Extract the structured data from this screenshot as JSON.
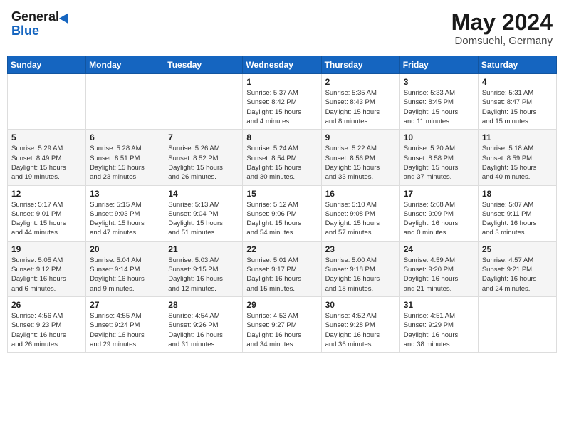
{
  "header": {
    "logo_general": "General",
    "logo_blue": "Blue",
    "title": "May 2024",
    "location": "Domsuehl, Germany"
  },
  "days_of_week": [
    "Sunday",
    "Monday",
    "Tuesday",
    "Wednesday",
    "Thursday",
    "Friday",
    "Saturday"
  ],
  "weeks": [
    [
      {
        "day": "",
        "info": ""
      },
      {
        "day": "",
        "info": ""
      },
      {
        "day": "",
        "info": ""
      },
      {
        "day": "1",
        "info": "Sunrise: 5:37 AM\nSunset: 8:42 PM\nDaylight: 15 hours\nand 4 minutes."
      },
      {
        "day": "2",
        "info": "Sunrise: 5:35 AM\nSunset: 8:43 PM\nDaylight: 15 hours\nand 8 minutes."
      },
      {
        "day": "3",
        "info": "Sunrise: 5:33 AM\nSunset: 8:45 PM\nDaylight: 15 hours\nand 11 minutes."
      },
      {
        "day": "4",
        "info": "Sunrise: 5:31 AM\nSunset: 8:47 PM\nDaylight: 15 hours\nand 15 minutes."
      }
    ],
    [
      {
        "day": "5",
        "info": "Sunrise: 5:29 AM\nSunset: 8:49 PM\nDaylight: 15 hours\nand 19 minutes."
      },
      {
        "day": "6",
        "info": "Sunrise: 5:28 AM\nSunset: 8:51 PM\nDaylight: 15 hours\nand 23 minutes."
      },
      {
        "day": "7",
        "info": "Sunrise: 5:26 AM\nSunset: 8:52 PM\nDaylight: 15 hours\nand 26 minutes."
      },
      {
        "day": "8",
        "info": "Sunrise: 5:24 AM\nSunset: 8:54 PM\nDaylight: 15 hours\nand 30 minutes."
      },
      {
        "day": "9",
        "info": "Sunrise: 5:22 AM\nSunset: 8:56 PM\nDaylight: 15 hours\nand 33 minutes."
      },
      {
        "day": "10",
        "info": "Sunrise: 5:20 AM\nSunset: 8:58 PM\nDaylight: 15 hours\nand 37 minutes."
      },
      {
        "day": "11",
        "info": "Sunrise: 5:18 AM\nSunset: 8:59 PM\nDaylight: 15 hours\nand 40 minutes."
      }
    ],
    [
      {
        "day": "12",
        "info": "Sunrise: 5:17 AM\nSunset: 9:01 PM\nDaylight: 15 hours\nand 44 minutes."
      },
      {
        "day": "13",
        "info": "Sunrise: 5:15 AM\nSunset: 9:03 PM\nDaylight: 15 hours\nand 47 minutes."
      },
      {
        "day": "14",
        "info": "Sunrise: 5:13 AM\nSunset: 9:04 PM\nDaylight: 15 hours\nand 51 minutes."
      },
      {
        "day": "15",
        "info": "Sunrise: 5:12 AM\nSunset: 9:06 PM\nDaylight: 15 hours\nand 54 minutes."
      },
      {
        "day": "16",
        "info": "Sunrise: 5:10 AM\nSunset: 9:08 PM\nDaylight: 15 hours\nand 57 minutes."
      },
      {
        "day": "17",
        "info": "Sunrise: 5:08 AM\nSunset: 9:09 PM\nDaylight: 16 hours\nand 0 minutes."
      },
      {
        "day": "18",
        "info": "Sunrise: 5:07 AM\nSunset: 9:11 PM\nDaylight: 16 hours\nand 3 minutes."
      }
    ],
    [
      {
        "day": "19",
        "info": "Sunrise: 5:05 AM\nSunset: 9:12 PM\nDaylight: 16 hours\nand 6 minutes."
      },
      {
        "day": "20",
        "info": "Sunrise: 5:04 AM\nSunset: 9:14 PM\nDaylight: 16 hours\nand 9 minutes."
      },
      {
        "day": "21",
        "info": "Sunrise: 5:03 AM\nSunset: 9:15 PM\nDaylight: 16 hours\nand 12 minutes."
      },
      {
        "day": "22",
        "info": "Sunrise: 5:01 AM\nSunset: 9:17 PM\nDaylight: 16 hours\nand 15 minutes."
      },
      {
        "day": "23",
        "info": "Sunrise: 5:00 AM\nSunset: 9:18 PM\nDaylight: 16 hours\nand 18 minutes."
      },
      {
        "day": "24",
        "info": "Sunrise: 4:59 AM\nSunset: 9:20 PM\nDaylight: 16 hours\nand 21 minutes."
      },
      {
        "day": "25",
        "info": "Sunrise: 4:57 AM\nSunset: 9:21 PM\nDaylight: 16 hours\nand 24 minutes."
      }
    ],
    [
      {
        "day": "26",
        "info": "Sunrise: 4:56 AM\nSunset: 9:23 PM\nDaylight: 16 hours\nand 26 minutes."
      },
      {
        "day": "27",
        "info": "Sunrise: 4:55 AM\nSunset: 9:24 PM\nDaylight: 16 hours\nand 29 minutes."
      },
      {
        "day": "28",
        "info": "Sunrise: 4:54 AM\nSunset: 9:26 PM\nDaylight: 16 hours\nand 31 minutes."
      },
      {
        "day": "29",
        "info": "Sunrise: 4:53 AM\nSunset: 9:27 PM\nDaylight: 16 hours\nand 34 minutes."
      },
      {
        "day": "30",
        "info": "Sunrise: 4:52 AM\nSunset: 9:28 PM\nDaylight: 16 hours\nand 36 minutes."
      },
      {
        "day": "31",
        "info": "Sunrise: 4:51 AM\nSunset: 9:29 PM\nDaylight: 16 hours\nand 38 minutes."
      },
      {
        "day": "",
        "info": ""
      }
    ]
  ]
}
